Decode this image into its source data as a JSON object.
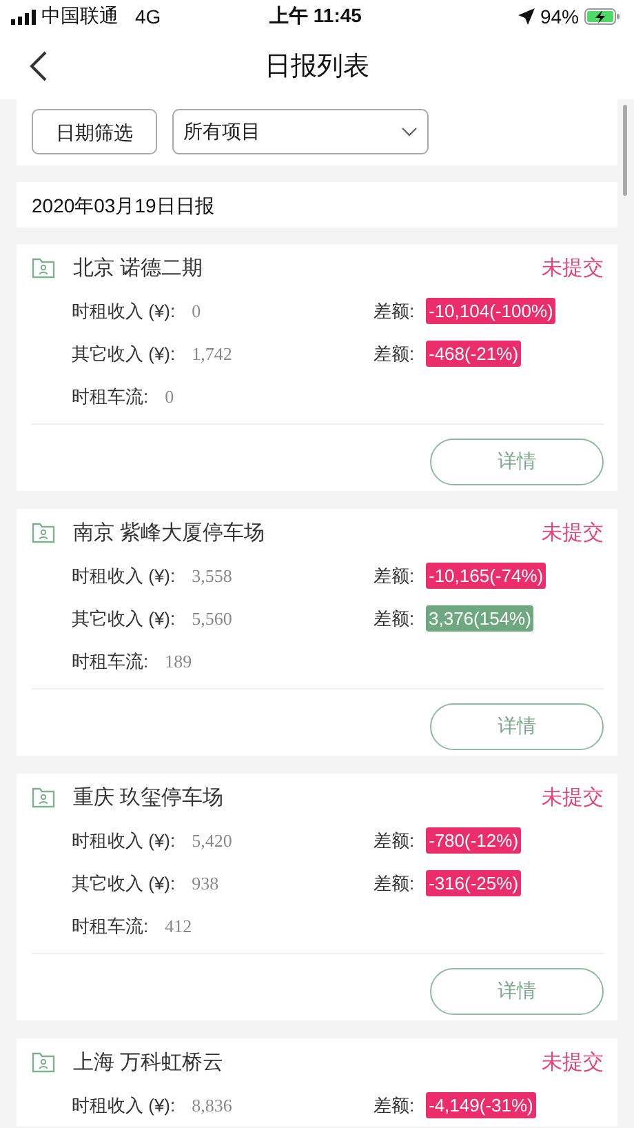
{
  "status_bar": {
    "carrier": "中国联通",
    "network": "4G",
    "time": "上午 11:45",
    "battery": "94%"
  },
  "nav": {
    "title": "日报列表"
  },
  "filters": {
    "date_button": "日期筛选",
    "project_select": "所有项目"
  },
  "section": {
    "title": "2020年03月19日日报"
  },
  "cards": [
    {
      "title": "北京 诺德二期",
      "status": "未提交",
      "rows": [
        {
          "kind": "money",
          "label": "时租收入 (¥):",
          "value": "0",
          "diff_label": "差额:",
          "diff": "-10,104(-100%)",
          "color": "#ec2d6c"
        },
        {
          "kind": "money",
          "label": "其它收入 (¥):",
          "value": "1,742",
          "diff_label": "差额:",
          "diff": "-468(-21%)",
          "color": "#ec2d6c"
        },
        {
          "kind": "plain",
          "label": "时租车流:",
          "value": "0"
        }
      ],
      "button": "详情"
    },
    {
      "title": "南京 紫峰大厦停车场",
      "status": "未提交",
      "rows": [
        {
          "kind": "money",
          "label": "时租收入 (¥):",
          "value": "3,558",
          "diff_label": "差额:",
          "diff": "-10,165(-74%)",
          "color": "#ec2d6c"
        },
        {
          "kind": "money",
          "label": "其它收入 (¥):",
          "value": "5,560",
          "diff_label": "差额:",
          "diff": "3,376(154%)",
          "color": "#6ea87f"
        },
        {
          "kind": "plain",
          "label": "时租车流:",
          "value": "189"
        }
      ],
      "button": "详情"
    },
    {
      "title": "重庆 玖玺停车场",
      "status": "未提交",
      "rows": [
        {
          "kind": "money",
          "label": "时租收入 (¥):",
          "value": "5,420",
          "diff_label": "差额:",
          "diff": "-780(-12%)",
          "color": "#ec2d6c"
        },
        {
          "kind": "money",
          "label": "其它收入 (¥):",
          "value": "938",
          "diff_label": "差额:",
          "diff": "-316(-25%)",
          "color": "#ec2d6c"
        },
        {
          "kind": "plain",
          "label": "时租车流:",
          "value": "412"
        }
      ],
      "button": "详情"
    },
    {
      "title": "上海 万科虹桥云",
      "status": "未提交",
      "rows": [
        {
          "kind": "money",
          "label": "时租收入 (¥):",
          "value": "8,836",
          "diff_label": "差额:",
          "diff": "-4,149(-31%)",
          "color": "#ec2d6c"
        }
      ]
    }
  ]
}
